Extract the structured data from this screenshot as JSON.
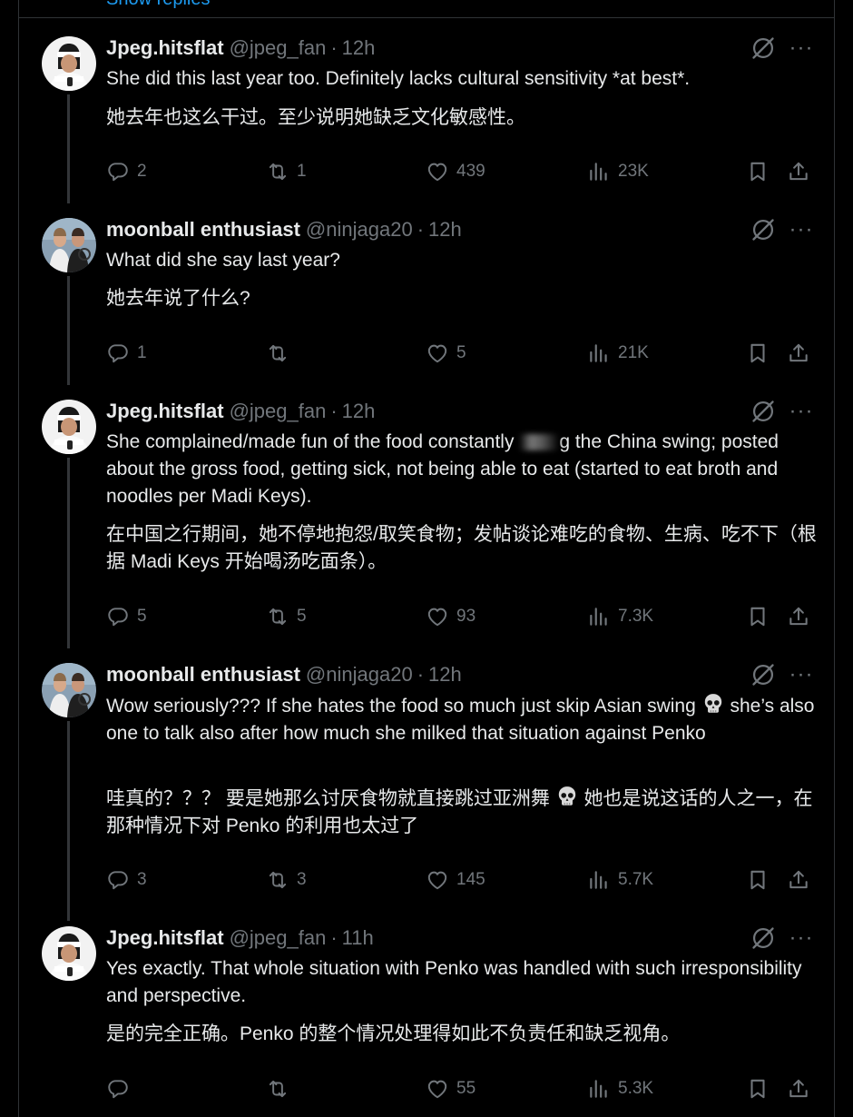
{
  "top": {
    "show_replies": "Show replies"
  },
  "tweets": [
    {
      "name": "Jpeg.hitsflat",
      "handle": "@jpeg_fan",
      "time": "12h",
      "text": "She did this last year too. Definitely lacks cultural sensitivity *at best*.",
      "translation": "她去年也这么干过。至少说明她缺乏文化敏感性。",
      "replies": "2",
      "reposts": "1",
      "likes": "439",
      "views": "23K"
    },
    {
      "name": "moonball enthusiast",
      "handle": "@ninjaga20",
      "time": "12h",
      "text": "What did she say last year?",
      "translation": "她去年说了什么?",
      "replies": "1",
      "reposts": "",
      "likes": "5",
      "views": "21K"
    },
    {
      "name": "Jpeg.hitsflat",
      "handle": "@jpeg_fan",
      "time": "12h",
      "text_part1": "She complained/made fun of the food constantly",
      "text_part2": "g the China swing; posted about the gross food, getting sick, not being able to eat (started to eat broth and noodles per Madi Keys).",
      "translation": "在中国之行期间，她不停地抱怨/取笑食物；发帖谈论难吃的食物、生病、吃不下（根据 Madi Keys 开始喝汤吃面条）。",
      "replies": "5",
      "reposts": "5",
      "likes": "93",
      "views": "7.3K"
    },
    {
      "name": "moonball enthusiast",
      "handle": "@ninjaga20",
      "time": "12h",
      "text_part1": "Wow seriously??? If she hates the food so much just skip Asian swing",
      "text_part2": "she’s also one to talk also after how much she milked that situation against Penko",
      "translation_part1": "哇真的？？？ 要是她那么讨厌食物就直接跳过亚洲舞",
      "translation_part2": "她也是说这话的人之一，在那种情况下对 Penko 的利用也太过了",
      "replies": "3",
      "reposts": "3",
      "likes": "145",
      "views": "5.7K"
    },
    {
      "name": "Jpeg.hitsflat",
      "handle": "@jpeg_fan",
      "time": "11h",
      "text": "Yes exactly. That whole situation with Penko was handled with such irresponsibility and perspective.",
      "translation": "是的完全正确。Penko 的整个情况处理得如此不负责任和缺乏视角。",
      "replies": "",
      "reposts": "",
      "likes": "55",
      "views": "5.3K"
    }
  ],
  "icons": {
    "reply": "reply-icon",
    "repost": "repost-icon",
    "like": "heart-icon",
    "views": "views-icon",
    "bookmark": "bookmark-icon",
    "share": "share-icon",
    "grok": "grok-icon",
    "more": "more-icon",
    "skull": "skull-emoji"
  },
  "colors": {
    "background": "#000000",
    "text": "#e7e9ea",
    "muted": "#71767b",
    "accent": "#1d9bf0",
    "border": "#2f3336"
  }
}
